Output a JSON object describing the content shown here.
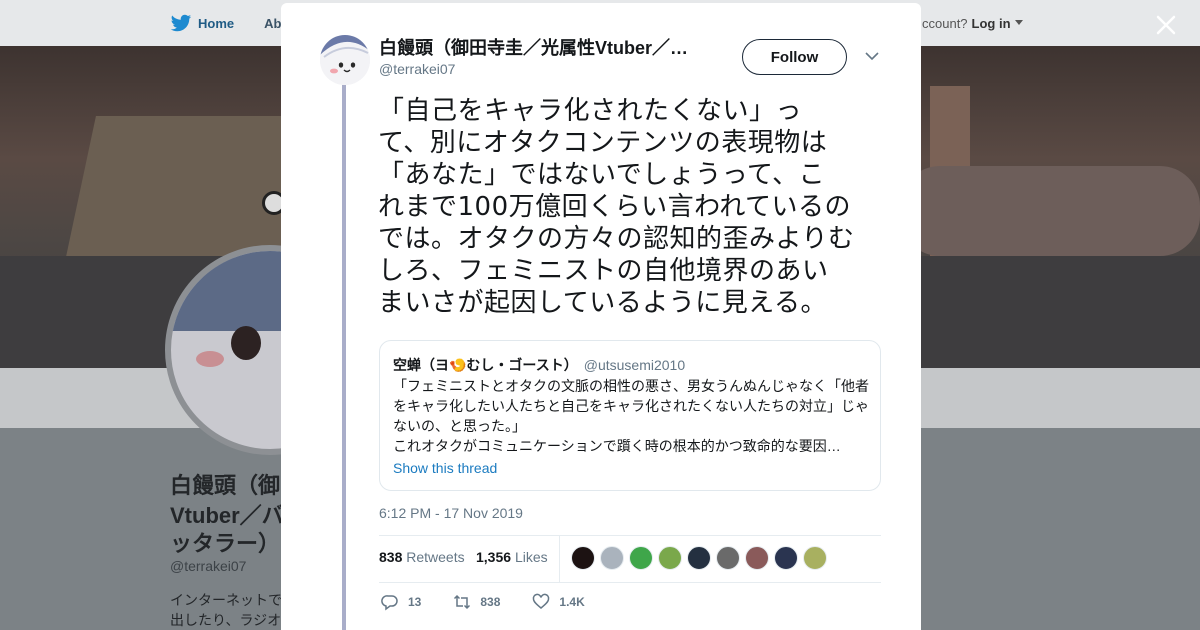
{
  "background": {
    "nav": {
      "home_label": "Home",
      "about_label": "Abo",
      "account_text": "ccount?",
      "login_label": "Log in"
    },
    "profile_name_line1": "白饅頭（御田",
    "profile_name_line2": "Vtuber／バ",
    "profile_name_line3": "ッタラー）",
    "profile_handle": "@terrakei07",
    "bio_line1": "インターネットで",
    "bio_line2": "出したり、ラジオ"
  },
  "modal": {
    "author": {
      "name": "白饅頭（御田寺圭／光属性Vtuber／…",
      "handle": "@terrakei07",
      "follow_label": "Follow"
    },
    "tweet_lines": [
      "「自己をキャラ化されたくない」っ",
      "て、別にオタクコンテンツの表現物は",
      "「あなた」ではないでしょうって、こ",
      "れまで100万億回くらい言われているの",
      "では。オタクの方々の認知的歪みよりむ",
      "しろ、フェミニストの自他境界のあい",
      "まいさが起因しているように見える。"
    ],
    "quote": {
      "name": "空蝉（ヨ🍤むし・ゴースト）",
      "handle": "@utsusemi2010",
      "lines": [
        "「フェミニストとオタクの文脈の相性の悪さ、男女うんぬんじゃなく「他者",
        "をキャラ化したい人たちと自己をキャラ化されたくない人たちの対立」じゃ",
        "ないの、と思った。」",
        "これオタクがコミュニケーションで躓く時の根本的かつ致命的な要因…"
      ],
      "show_thread_label": "Show this thread"
    },
    "timestamp": "6:12 PM - 17 Nov 2019",
    "stats": {
      "retweets_count": "838",
      "retweets_label": "Retweets",
      "likes_count": "1,356",
      "likes_label": "Likes"
    },
    "liker_colors": [
      "#1c1212",
      "#aab3bd",
      "#3fa64a",
      "#7aa84b",
      "#243040",
      "#6a6a6a",
      "#8a5a5a",
      "#2a3450",
      "#a8b060"
    ],
    "actions": {
      "reply_count": "13",
      "retweet_count": "838",
      "like_count": "1.4K"
    }
  }
}
